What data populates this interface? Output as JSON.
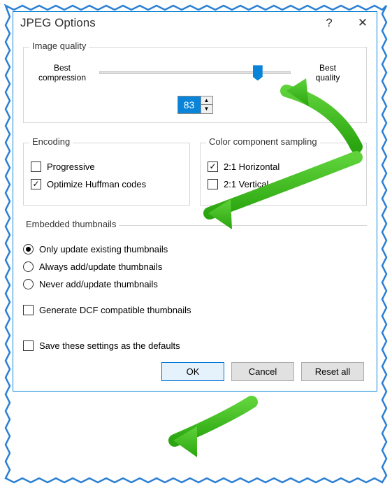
{
  "window": {
    "title": "JPEG Options",
    "help_label": "?",
    "close_label": "✕"
  },
  "quality": {
    "legend": "Image quality",
    "left_label_line1": "Best",
    "left_label_line2": "compression",
    "right_label_line1": "Best",
    "right_label_line2": "quality",
    "value": "83",
    "slider_percent": 83
  },
  "encoding": {
    "legend": "Encoding",
    "progressive": {
      "label": "Progressive",
      "checked": false
    },
    "huffman": {
      "label": "Optimize Huffman codes",
      "checked": true
    }
  },
  "sampling": {
    "legend": "Color component sampling",
    "h21": {
      "label": "2:1 Horizontal",
      "checked": true
    },
    "v21": {
      "label": "2:1 Vertical",
      "checked": false
    }
  },
  "thumbnails": {
    "legend": "Embedded thumbnails",
    "options": [
      {
        "label": "Only update existing thumbnails",
        "checked": true
      },
      {
        "label": "Always add/update thumbnails",
        "checked": false
      },
      {
        "label": "Never add/update thumbnails",
        "checked": false
      }
    ]
  },
  "dcf": {
    "label": "Generate DCF compatible thumbnails",
    "checked": false
  },
  "save_defaults": {
    "label": "Save these settings as the defaults",
    "checked": false
  },
  "buttons": {
    "ok": "OK",
    "cancel": "Cancel",
    "reset": "Reset all"
  }
}
